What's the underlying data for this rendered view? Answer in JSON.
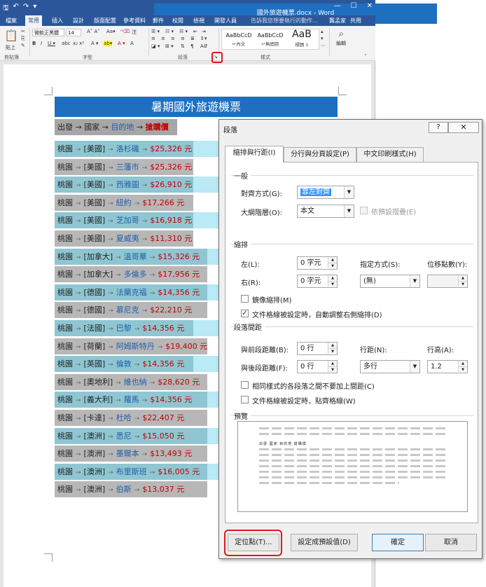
{
  "window": {
    "title": "國外旅遊機票.docx - Word",
    "min": "—",
    "max": "☐",
    "close": "✕"
  },
  "qat": {
    "save": "🖫",
    "undo": "↶",
    "redo": "↷",
    "more": "▾"
  },
  "tabs": [
    "檔案",
    "常用",
    "插入",
    "設計",
    "版面配置",
    "參考資料",
    "郵件",
    "校閱",
    "檢視",
    "開發人員"
  ],
  "active_tab": "常用",
  "tell_me": "告訴我您想要執行的動作...",
  "user": "龔孟家",
  "share": "共用",
  "ribbon": {
    "paste": "貼上",
    "font_name": "微軟正黑體",
    "font_size": "14",
    "groups": {
      "clipboard": "剪貼簿",
      "font": "字型",
      "paragraph": "段落",
      "styles": "樣式",
      "editing": "編輯"
    },
    "styles": [
      {
        "sample": "AaBbCcD",
        "name": "↵內文"
      },
      {
        "sample": "AaBbCcD",
        "name": "↵無間距"
      },
      {
        "sample": "AaB",
        "name": "標題 1"
      }
    ],
    "edit_label": "編輯"
  },
  "document": {
    "title": "暑期國外旅遊機票",
    "header": {
      "from": "出發",
      "country": "國家",
      "dest": "目的地",
      "price": "搶購價"
    },
    "rows": [
      {
        "from": "桃園",
        "country": "[美國]",
        "city": "洛杉磯",
        "price": "$25,326 元"
      },
      {
        "from": "桃園",
        "country": "[美國]",
        "city": "三藩市",
        "price": "$25,326 元"
      },
      {
        "from": "桃園",
        "country": "[美國]",
        "city": "西雅圖",
        "price": "$26,910 元"
      },
      {
        "from": "桃園",
        "country": "[美國]",
        "city": "紐約",
        "price": "$17,266 元"
      },
      {
        "from": "桃園",
        "country": "[美國]",
        "city": "芝加哥",
        "price": "$16,918 元"
      },
      {
        "from": "桃園",
        "country": "[美國]",
        "city": "夏威夷",
        "price": "$11,310 元"
      },
      {
        "from": "桃園",
        "country": "[加拿大]",
        "city": "溫哥華",
        "price": "$15,326 元"
      },
      {
        "from": "桃園",
        "country": "[加拿大]",
        "city": "多倫多",
        "price": "$17,956 元"
      },
      {
        "from": "桃園",
        "country": "[德國]",
        "city": "法蘭克福",
        "price": "$14,356 元"
      },
      {
        "from": "桃園",
        "country": "[德國]",
        "city": "慕尼克",
        "price": "$22,210 元"
      },
      {
        "from": "桃園",
        "country": "[法國]",
        "city": "巴黎",
        "price": "$14,356 元"
      },
      {
        "from": "桃園",
        "country": "[荷蘭]",
        "city": "阿姆斯特丹",
        "price": "$19,400 元"
      },
      {
        "from": "桃園",
        "country": "[英國]",
        "city": "倫敦",
        "price": "$14,356 元"
      },
      {
        "from": "桃園",
        "country": "[奧地利]",
        "city": "維也納",
        "price": "$28,620 元"
      },
      {
        "from": "桃園",
        "country": "[義大利]",
        "city": "羅馬",
        "price": "$14,356 元"
      },
      {
        "from": "桃園",
        "country": "[卡達]",
        "city": "杜哈",
        "price": "$22,407 元"
      },
      {
        "from": "桃園",
        "country": "[澳洲]",
        "city": "悉尼",
        "price": "$15,050 元"
      },
      {
        "from": "桃園",
        "country": "[澳洲]",
        "city": "墨爾本",
        "price": "$13,493 元"
      },
      {
        "from": "桃園",
        "country": "[澳洲]",
        "city": "布里斯班",
        "price": "$16,005 元"
      },
      {
        "from": "桃園",
        "country": "[澳洲]",
        "city": "伯斯",
        "price": "$13,037 元"
      }
    ]
  },
  "dialog": {
    "title": "段落",
    "help": "?",
    "close": "✕",
    "tabs": [
      "縮排與行距(I)",
      "分行與分頁設定(P)",
      "中文印刷樣式(H)"
    ],
    "general": {
      "section": "一般",
      "alignment_label": "對齊方式(G):",
      "alignment_value": "靠左對齊",
      "outline_label": "大綱階層(O):",
      "outline_value": "本文",
      "collapsed_label": "依預設摺疊(E)"
    },
    "indent": {
      "section": "縮排",
      "left_label": "左(L):",
      "left_value": "0 字元",
      "right_label": "右(R):",
      "right_value": "0 字元",
      "special_label": "指定方式(S):",
      "special_value": "(無)",
      "by_label": "位移點數(Y):",
      "by_value": "",
      "mirror_label": "鏡像縮排(M)",
      "auto_adjust_label": "文件格線被設定時，自動調整右側縮排(D)"
    },
    "spacing": {
      "section": "段落間距",
      "before_label": "與前段距離(B):",
      "before_value": "0 行",
      "after_label": "與後段距離(F):",
      "after_value": "0 行",
      "line_spacing_label": "行距(N):",
      "line_spacing_value": "多行",
      "at_label": "行高(A):",
      "at_value": "1.2",
      "no_space_label": "相同樣式的各段落之間不要加上間距(C)",
      "snap_label": "文件格線被設定時，貼齊格線(W)"
    },
    "preview": {
      "section": "預覽",
      "sample": "出發 國家 目的地 搶購價"
    },
    "checks": {
      "mirror": false,
      "auto_adjust": true,
      "no_space": false,
      "snap": false,
      "collapsed": false
    },
    "buttons": {
      "tabs": "定位點(T)...",
      "default": "設定成預設值(D)",
      "ok": "確定",
      "cancel": "取消"
    }
  }
}
